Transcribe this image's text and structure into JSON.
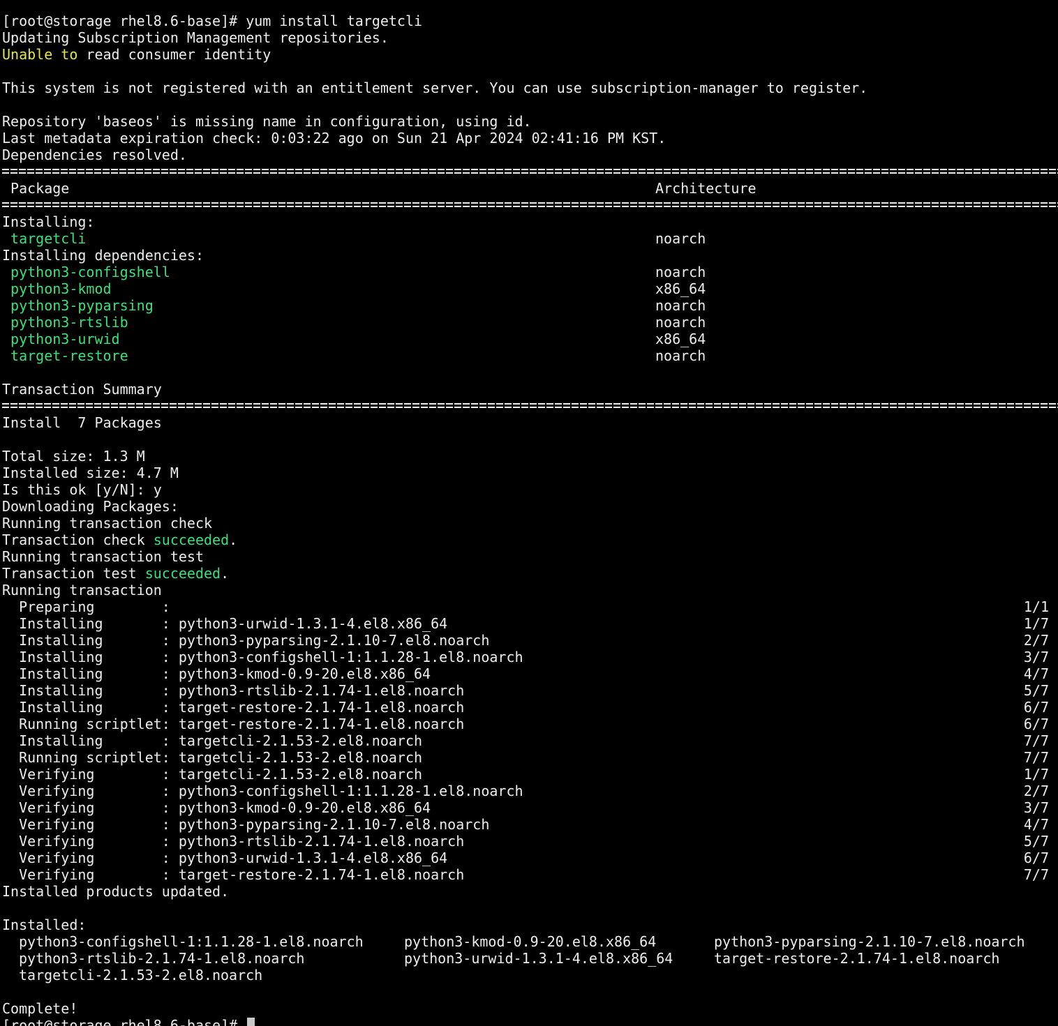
{
  "terminal": {
    "prompt": "[root@storage rhel8.6-base]#",
    "command": " yum install targetcli",
    "lines": {
      "updating": "Updating Subscription Management repositories.",
      "unable_a": "Unable to",
      "unable_b": " read consumer identity",
      "not_registered": "This system is not registered with an entitlement server. You can use subscription-manager to register.",
      "repo_missing": "Repository 'baseos' is missing name in configuration, using id.",
      "metadata": "Last metadata expiration check: 0:03:22 ago on Sun 21 Apr 2024 02:41:16 PM KST.",
      "deps_resolved": "Dependencies resolved."
    },
    "table": {
      "header_package": " Package",
      "header_arch": "Architecture",
      "installing_label": "Installing:",
      "dependencies_label": "Installing dependencies:",
      "main_packages": [
        {
          "name": "targetcli",
          "arch": "noarch"
        }
      ],
      "dependencies": [
        {
          "name": "python3-configshell",
          "arch": "noarch"
        },
        {
          "name": "python3-kmod",
          "arch": "x86_64"
        },
        {
          "name": "python3-pyparsing",
          "arch": "noarch"
        },
        {
          "name": "python3-rtslib",
          "arch": "noarch"
        },
        {
          "name": "python3-urwid",
          "arch": "x86_64"
        },
        {
          "name": "target-restore",
          "arch": "noarch"
        }
      ]
    },
    "summary": {
      "title": "Transaction Summary",
      "install": "Install  7 Packages",
      "total_size": "Total size: 1.3 M",
      "installed_size": "Installed size: 4.7 M",
      "confirm": "Is this ok [y/N]: y",
      "downloading": "Downloading Packages:",
      "check_running": "Running transaction check",
      "check_a": "Transaction check ",
      "check_ok": "succeeded",
      "check_end": ".",
      "test_running": "Running transaction test",
      "test_a": "Transaction test ",
      "test_ok": "succeeded",
      "test_end": ".",
      "running": "Running transaction"
    },
    "steps": [
      {
        "text": "  Preparing        :",
        "count": "1/1"
      },
      {
        "text": "  Installing       : python3-urwid-1.3.1-4.el8.x86_64",
        "count": "1/7"
      },
      {
        "text": "  Installing       : python3-pyparsing-2.1.10-7.el8.noarch",
        "count": "2/7"
      },
      {
        "text": "  Installing       : python3-configshell-1:1.1.28-1.el8.noarch",
        "count": "3/7"
      },
      {
        "text": "  Installing       : python3-kmod-0.9-20.el8.x86_64",
        "count": "4/7"
      },
      {
        "text": "  Installing       : python3-rtslib-2.1.74-1.el8.noarch",
        "count": "5/7"
      },
      {
        "text": "  Installing       : target-restore-2.1.74-1.el8.noarch",
        "count": "6/7"
      },
      {
        "text": "  Running scriptlet: target-restore-2.1.74-1.el8.noarch",
        "count": "6/7"
      },
      {
        "text": "  Installing       : targetcli-2.1.53-2.el8.noarch",
        "count": "7/7"
      },
      {
        "text": "  Running scriptlet: targetcli-2.1.53-2.el8.noarch",
        "count": "7/7"
      },
      {
        "text": "  Verifying        : targetcli-2.1.53-2.el8.noarch",
        "count": "1/7"
      },
      {
        "text": "  Verifying        : python3-configshell-1:1.1.28-1.el8.noarch",
        "count": "2/7"
      },
      {
        "text": "  Verifying        : python3-kmod-0.9-20.el8.x86_64",
        "count": "3/7"
      },
      {
        "text": "  Verifying        : python3-pyparsing-2.1.10-7.el8.noarch",
        "count": "4/7"
      },
      {
        "text": "  Verifying        : python3-rtslib-2.1.74-1.el8.noarch",
        "count": "5/7"
      },
      {
        "text": "  Verifying        : python3-urwid-1.3.1-4.el8.x86_64",
        "count": "6/7"
      },
      {
        "text": "  Verifying        : target-restore-2.1.74-1.el8.noarch",
        "count": "7/7"
      }
    ],
    "products_updated": "Installed products updated.",
    "installed_label": "Installed:",
    "installed_rows": [
      [
        "python3-configshell-1:1.1.28-1.el8.noarch",
        "python3-kmod-0.9-20.el8.x86_64",
        "python3-pyparsing-2.1.10-7.el8.noarch"
      ],
      [
        "python3-rtslib-2.1.74-1.el8.noarch",
        "python3-urwid-1.3.1-4.el8.x86_64",
        "target-restore-2.1.74-1.el8.noarch"
      ],
      [
        "targetcli-2.1.53-2.el8.noarch",
        "",
        ""
      ]
    ],
    "complete": "Complete!",
    "final_prompt": "[root@storage rhel8.6-base]# ",
    "colors": {
      "background": "#000000",
      "text": "#ececec",
      "warning": "#e5e54a",
      "package": "#3be07a",
      "cursor": "#c9c9c9"
    }
  }
}
